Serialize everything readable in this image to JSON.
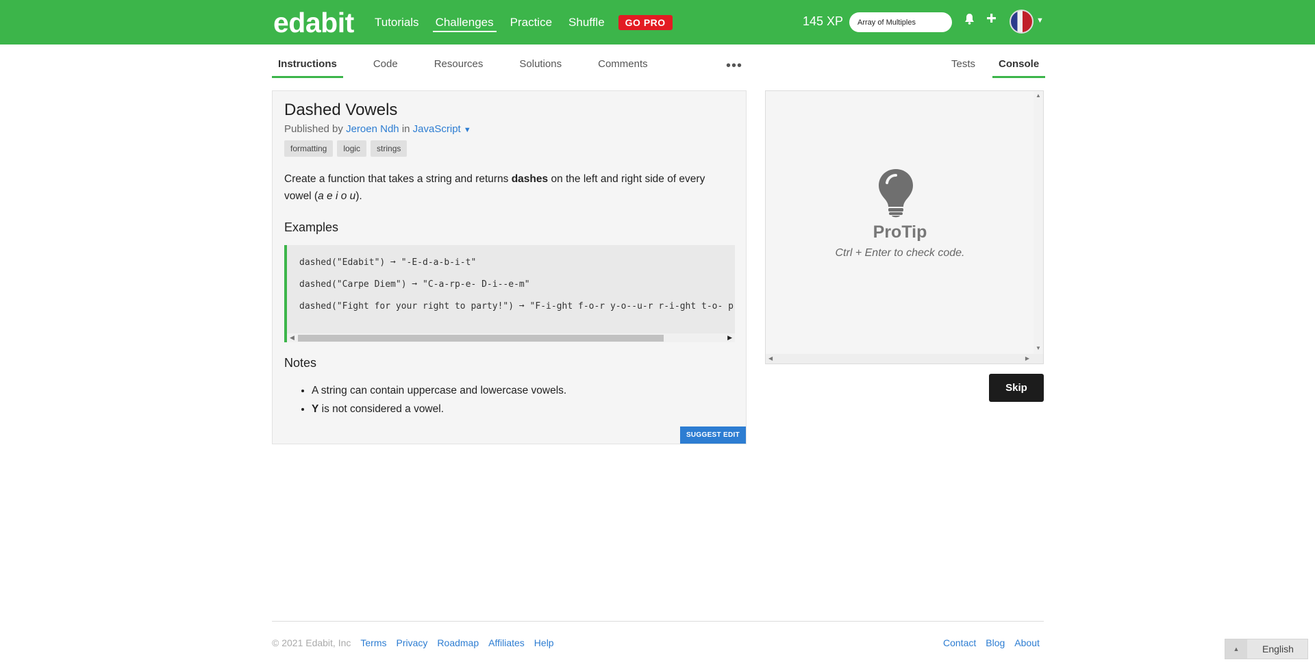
{
  "header": {
    "logo": "edabit",
    "nav": [
      "Tutorials",
      "Challenges",
      "Practice",
      "Shuffle"
    ],
    "gopro": "GO PRO",
    "xp": "145 XP",
    "search_value": "Array of Multiples"
  },
  "tabs": {
    "left": [
      "Instructions",
      "Code",
      "Resources",
      "Solutions",
      "Comments"
    ],
    "more": "•••",
    "right": [
      "Tests",
      "Console"
    ]
  },
  "challenge": {
    "title": "Dashed Vowels",
    "published_by": "Published by",
    "author": "Jeroen Ndh",
    "in": "in",
    "language": "JavaScript",
    "tags": [
      "formatting",
      "logic",
      "strings"
    ],
    "desc_1": "Create a function that takes a string and returns ",
    "desc_bold": "dashes",
    "desc_2": " on the left and right side of every vowel (",
    "desc_italic": "a e i o u",
    "desc_3": ").",
    "examples_heading": "Examples",
    "examples": [
      "dashed(\"Edabit\") ➞ \"-E-d-a-b-i-t\"",
      "dashed(\"Carpe Diem\") ➞ \"C-a-rp-e- D-i--e-m\"",
      "dashed(\"Fight for your right to party!\") ➞ \"F-i-ght f-o-r y-o--u-r r-i-ght t-o- p-a-rty!\""
    ],
    "notes_heading": "Notes",
    "note_1": "A string can contain uppercase and lowercase vowels.",
    "note_2_bold": "Y",
    "note_2_rest": " is not considered a vowel.",
    "suggest_edit": "SUGGEST EDIT"
  },
  "console": {
    "protip": "ProTip",
    "protip_sub": "Ctrl + Enter to check code.",
    "skip": "Skip"
  },
  "footer": {
    "copyright": "© 2021 Edabit, Inc",
    "left_links": [
      "Terms",
      "Privacy",
      "Roadmap",
      "Affiliates",
      "Help"
    ],
    "right_links": [
      "Contact",
      "Blog",
      "About"
    ],
    "language": "English"
  },
  "colors": {
    "brand_green": "#3cb54a",
    "link_blue": "#2d7dd2",
    "gopro_red": "#e31b23"
  }
}
